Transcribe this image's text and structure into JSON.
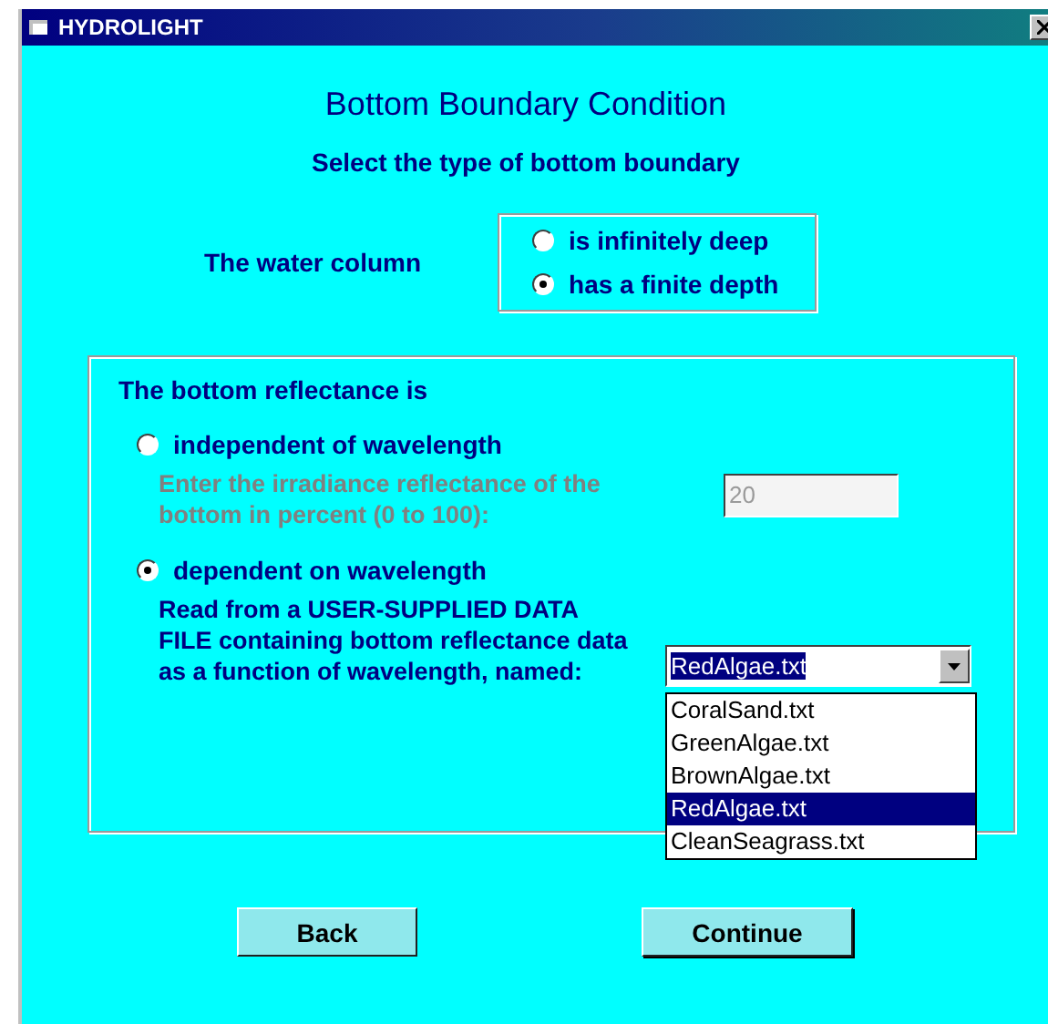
{
  "window": {
    "title": "HYDROLIGHT"
  },
  "heading": "Bottom Boundary Condition",
  "subheading": "Select the type of bottom boundary",
  "water_column": {
    "label": "The water column",
    "options": [
      {
        "label": "is infinitely deep",
        "selected": false
      },
      {
        "label": "has a finite depth",
        "selected": true
      }
    ]
  },
  "reflectance": {
    "label": "The bottom reflectance is",
    "options": [
      {
        "kind": "percent",
        "label": "independent of wavelength",
        "selected": false,
        "description": "Enter the irradiance reflectance of the bottom in percent (0 to 100):",
        "disabled": true,
        "value": "20"
      },
      {
        "kind": "file",
        "label": "dependent on wavelength",
        "selected": true,
        "description": "Read from a USER-SUPPLIED DATA FILE containing bottom reflectance data as a function of wavelength, named:",
        "disabled": false,
        "value": "RedAlgae.txt",
        "expanded": true,
        "items": [
          {
            "label": "CoralSand.txt",
            "selected": false
          },
          {
            "label": "GreenAlgae.txt",
            "selected": false
          },
          {
            "label": "BrownAlgae.txt",
            "selected": false
          },
          {
            "label": "RedAlgae.txt",
            "selected": true
          },
          {
            "label": "CleanSeagrass.txt",
            "selected": false
          }
        ]
      }
    ]
  },
  "buttons": [
    {
      "label": "Back",
      "default": false
    },
    {
      "label": "Continue",
      "default": true
    }
  ]
}
